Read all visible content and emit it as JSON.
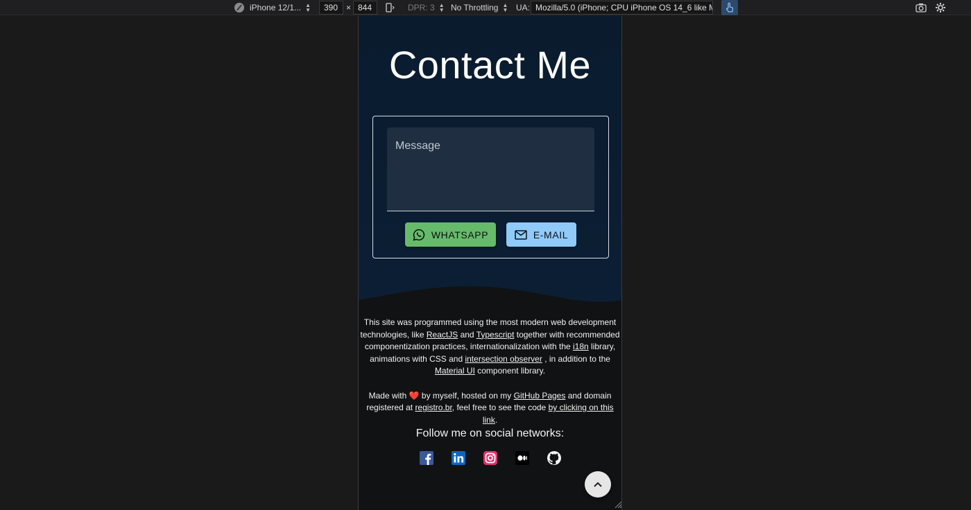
{
  "devtools": {
    "device": "iPhone 12/1...",
    "width": "390",
    "times": "×",
    "height": "844",
    "dpr": "DPR: 3",
    "throttling": "No Throttling",
    "ua_label": "UA:",
    "ua_value": "Mozilla/5.0 (iPhone; CPU iPhone OS 14_6 like M"
  },
  "contact": {
    "title": "Contact Me",
    "message_placeholder": "Message",
    "whatsapp_label": "WHATSAPP",
    "email_label": "E-MAIL"
  },
  "footer": {
    "p1": {
      "t1": "This site was programmed using the most modern web development technologies, like ",
      "reactjs": "ReactJS",
      "t2": " and ",
      "typescript": "Typescript",
      "t3": " together with recommended componentization practices, internationalization with the ",
      "i18n": "i18n",
      "t4": " library, animations with CSS and ",
      "observer": "intersection observer",
      "t5": " , in addition to the ",
      "material": "Material UI",
      "t6": " component library."
    },
    "p2": {
      "t1": "Made with ",
      "heart": "❤️",
      "t2": " by myself, hosted on my ",
      "github_pages": "GitHub Pages",
      "t3": " and domain registered at ",
      "registro": "registro.br",
      "t4": ", feel free to see the code ",
      "code_link": "by clicking on this link",
      "t5": "."
    },
    "follow": "Follow me on social networks:"
  },
  "socials": [
    "facebook-icon",
    "linkedin-icon",
    "instagram-icon",
    "medium-icon",
    "github-icon"
  ],
  "colors": {
    "contact_bg": "#0b1d31",
    "footer_bg": "#111213",
    "whatsapp": "#66bb6a",
    "email": "#90caf9"
  }
}
